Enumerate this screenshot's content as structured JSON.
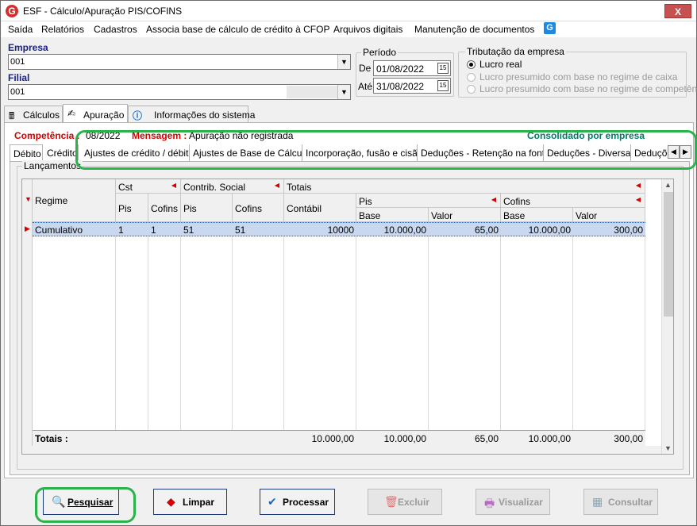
{
  "window": {
    "title": "ESF - Cálculo/Apuração PIS/COFINS",
    "close_label": "X"
  },
  "menu": [
    "Saída",
    "Relatórios",
    "Cadastros",
    "Associa base de cálculo de crédito à CFOP",
    "Arquivos digitais",
    "Manutenção de documentos"
  ],
  "empresa": {
    "label": "Empresa",
    "value": "001 ",
    "dropdown": "▼"
  },
  "filial": {
    "label": "Filial",
    "value": "001",
    "dropdown": "▼"
  },
  "periodo": {
    "label": "Período",
    "de_label": "De",
    "de_value": "01/08/2022",
    "ate_label": "Até",
    "ate_value": "31/08/2022",
    "cal": "15"
  },
  "tributacao": {
    "label": "Tributação da empresa",
    "options": [
      {
        "label": "Lucro real",
        "selected": true,
        "enabled": true
      },
      {
        "label": "Lucro presumido com base no regime de caixa",
        "selected": false,
        "enabled": false
      },
      {
        "label": "Lucro presumido com base no regime de competência",
        "selected": false,
        "enabled": false
      }
    ]
  },
  "main_tabs": [
    {
      "label": "Cálculos",
      "icon": "calc-icon"
    },
    {
      "label": "Apuração",
      "icon": "apuracao-icon",
      "active": true
    },
    {
      "label": "Informações do sistema",
      "icon": "info-icon"
    }
  ],
  "status": {
    "competencia_label": "Competência :",
    "competencia_value": "08/2022",
    "mensagem_label": "Mensagem :",
    "mensagem_value": "Apuração não registrada",
    "consolidado": "Consolidado por empresa"
  },
  "sub_tabs": [
    "Débito",
    "Crédito",
    "Ajustes de crédito / débito",
    "Ajustes de Base de Cálculo",
    "Incorporação, fusão e cisão",
    "Deduções - Retenção na fonte",
    "Deduções - Diversas",
    "Deduções"
  ],
  "scroll_left": "◀",
  "scroll_right": "▶",
  "lancamentos": {
    "label": "Lançamentos",
    "headers": {
      "regime": "Regime",
      "cst": "Cst",
      "contrib": "Contrib. Social",
      "totais": "Totais",
      "pis": "Pis",
      "cofins": "Cofins",
      "contabil": "Contábil",
      "base": "Base",
      "valor": "Valor"
    },
    "rows": [
      {
        "regime": "Cumulativo",
        "cst_pis": "1",
        "cst_cofins": "1",
        "cs_pis": "51",
        "cs_cofins": "51",
        "contabil": "10000",
        "pis_base": "10.000,00",
        "pis_valor": "65,00",
        "cofins_base": "10.000,00",
        "cofins_valor": "300,00"
      }
    ],
    "totals": {
      "label": "Totais :",
      "contabil": "10.000,00",
      "pis_base": "10.000,00",
      "pis_valor": "65,00",
      "cofins_base": "10.000,00",
      "cofins_valor": "300,00"
    }
  },
  "buttons": {
    "pesquisar": "Pesquisar",
    "limpar": "Limpar",
    "processar": "Processar",
    "excluir": "Excluir",
    "visualizar": "Visualizar",
    "consultar": "Consultar"
  },
  "colors": {
    "accent": "#1c3c78",
    "highlight": "#2bb24c",
    "label_red": "#d50000",
    "label_teal": "#00796b"
  }
}
